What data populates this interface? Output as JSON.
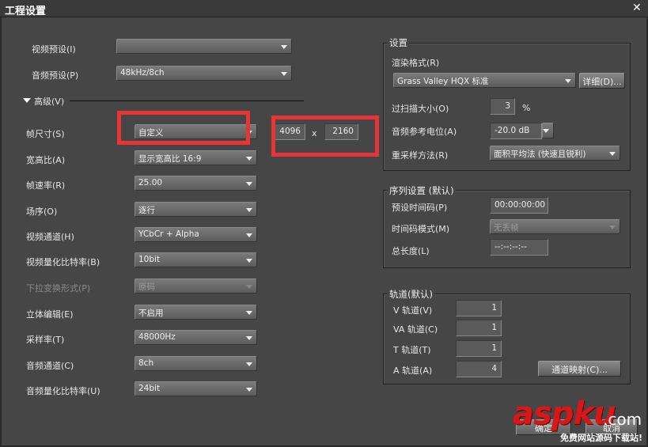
{
  "window": {
    "title": "工程设置",
    "close_icon": "close-icon"
  },
  "left": {
    "video_preset": {
      "label": "视频预设(I)",
      "value": ""
    },
    "audio_preset": {
      "label": "音频预设(P)",
      "value": "48kHz/8ch"
    },
    "advanced_label": "高级(V)",
    "frame_size": {
      "label": "帧尺寸(S)",
      "value": "自定义",
      "width": "4096",
      "x": "x",
      "height": "2160"
    },
    "rows": [
      {
        "label": "宽高比(A)",
        "value": "显示宽高比 16:9",
        "disabled": false
      },
      {
        "label": "帧速率(R)",
        "value": "25.00",
        "disabled": false
      },
      {
        "label": "场序(O)",
        "value": "逐行",
        "disabled": false
      },
      {
        "label": "视频通道(H)",
        "value": "YCbCr + Alpha",
        "disabled": false
      },
      {
        "label": "视频量化比特率(B)",
        "value": "10bit",
        "disabled": false
      },
      {
        "label": "下拉变换形式(P)",
        "value": "原码",
        "disabled": true
      },
      {
        "label": "立体编辑(E)",
        "value": "不启用",
        "disabled": false
      },
      {
        "label": "采样率(T)",
        "value": "48000Hz",
        "disabled": false
      },
      {
        "label": "音频通道(C)",
        "value": "8ch",
        "disabled": false
      },
      {
        "label": "音频量化比特率(U)",
        "value": "24bit",
        "disabled": false
      }
    ]
  },
  "settings": {
    "title": "设置",
    "render_format_label": "渲染格式(R)",
    "render_format_value": "Grass Valley HQX 标准",
    "details_button": "详细(D)...",
    "overscan_label": "过扫描大小(O)",
    "overscan_value": "3",
    "overscan_unit": "%",
    "audio_ref_label": "音频参考电位(A)",
    "audio_ref_value": "-20.0 dB",
    "resample_label": "重采样方法(R)",
    "resample_value": "面积平均法 (快速且锐利)"
  },
  "sequence": {
    "title": "序列设置 (默认)",
    "timecode_label": "预设时间码(P)",
    "timecode_value": "00:00:00:00",
    "tc_mode_label": "时间码模式(M)",
    "tc_mode_value": "无丢帧",
    "duration_label": "总长度(L)",
    "duration_value": "--:--:--:--"
  },
  "tracks": {
    "title": "轨道(默认)",
    "v_label": "V 轨道(V)",
    "v_value": "1",
    "va_label": "VA 轨道(C)",
    "va_value": "1",
    "t_label": "T 轨道(T)",
    "t_value": "1",
    "a_label": "A 轨道(A)",
    "a_value": "4",
    "channel_map_button": "通道映射(C)..."
  },
  "footer": {
    "ok": "确定",
    "cancel": "取消"
  },
  "watermark": {
    "brand": "aspku",
    "suffix": ".com",
    "tagline": "免费网站源码下载站!"
  },
  "colors": {
    "highlight": "#e83434",
    "background": "#464646"
  }
}
